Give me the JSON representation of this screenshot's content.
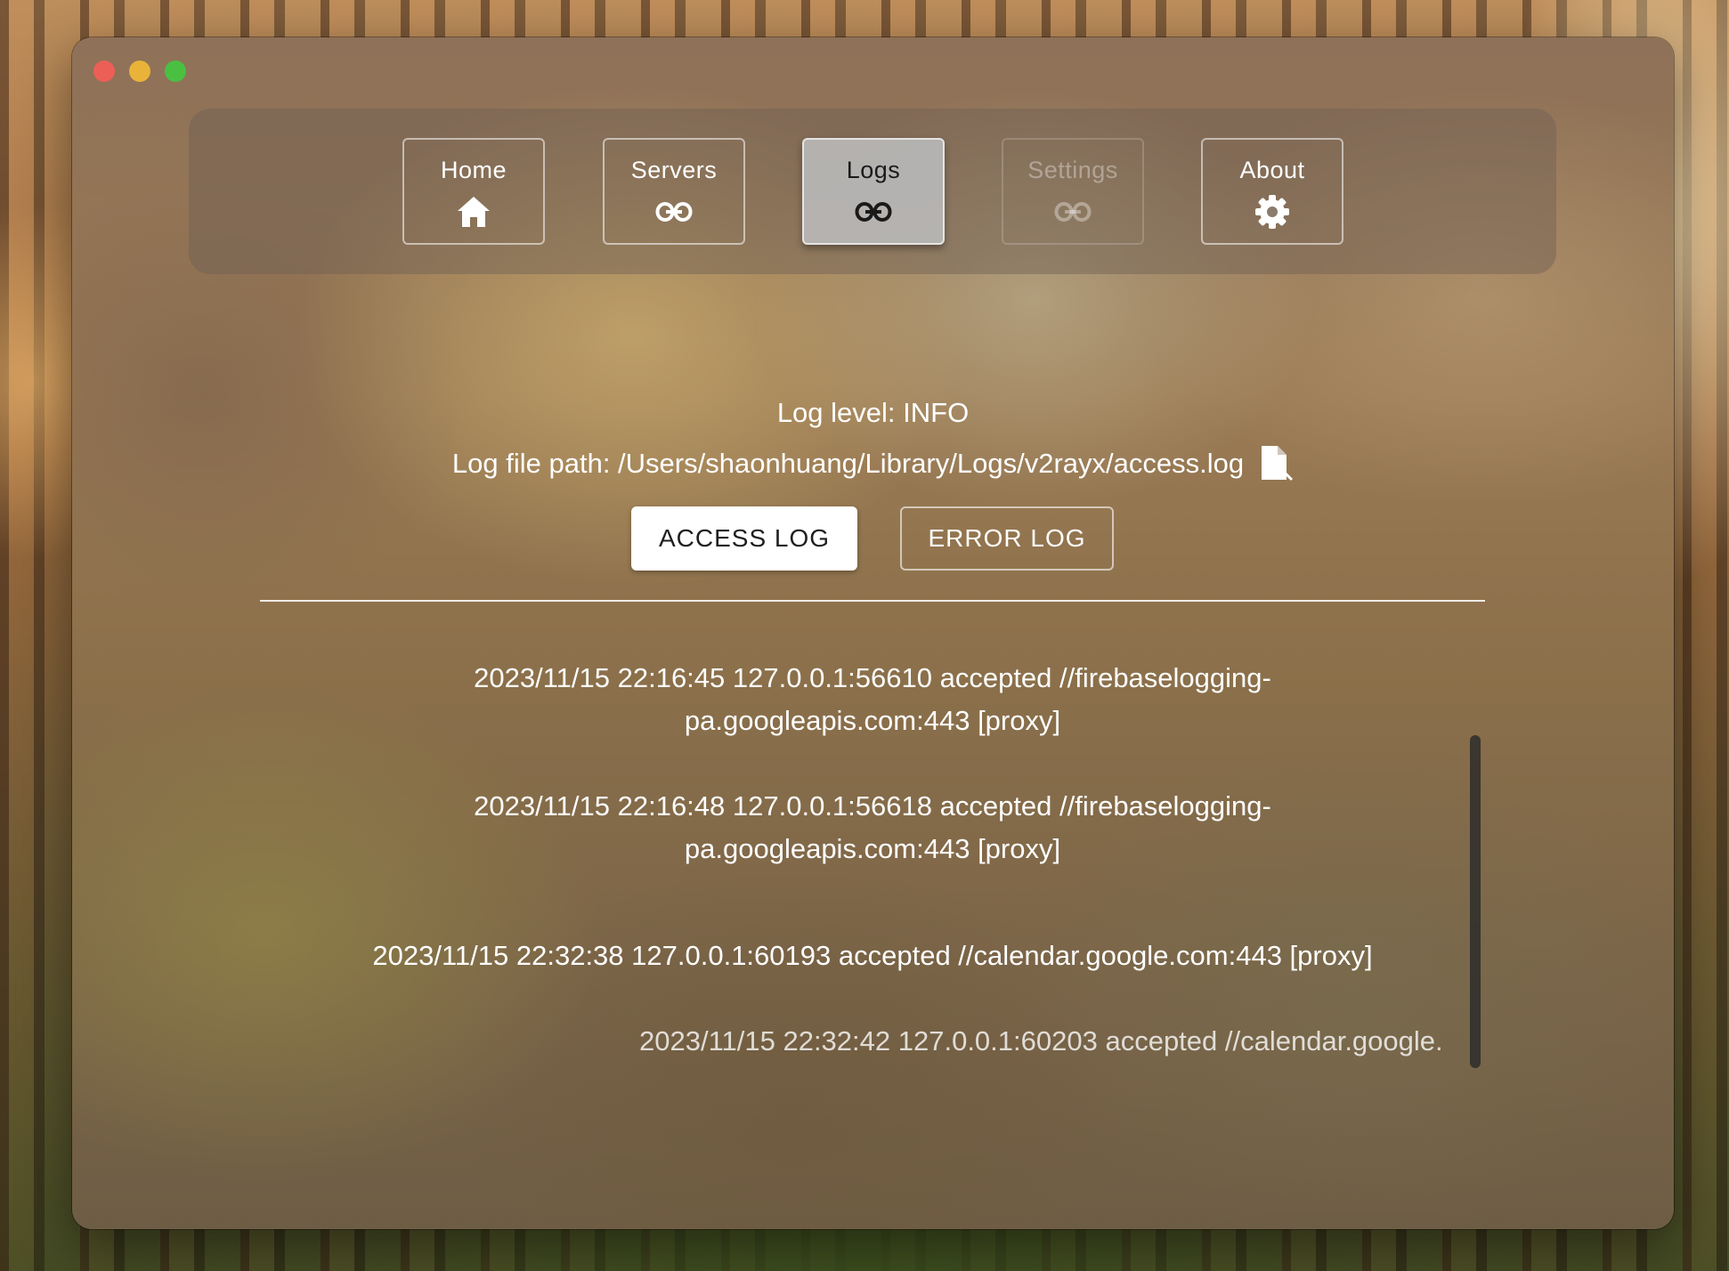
{
  "window_controls": [
    "close",
    "minimize",
    "zoom"
  ],
  "nav": {
    "items": [
      {
        "label": "Home",
        "icon": "home-icon",
        "state": "normal"
      },
      {
        "label": "Servers",
        "icon": "link-icon",
        "state": "normal"
      },
      {
        "label": "Logs",
        "icon": "link-icon",
        "state": "active"
      },
      {
        "label": "Settings",
        "icon": "link-icon",
        "state": "disabled"
      },
      {
        "label": "About",
        "icon": "gear-icon",
        "state": "normal"
      }
    ]
  },
  "log_info": {
    "level_text": "Log level: INFO",
    "path_text": "Log file path: /Users/shaonhuang/Library/Logs/v2rayx/access.log",
    "path_icon": "file-open-icon"
  },
  "log_tabs": {
    "access_label": "ACCESS LOG",
    "error_label": "ERROR LOG",
    "selected": "ACCESS LOG"
  },
  "log_entries": [
    {
      "line1": "2023/11/15 22:16:45 127.0.0.1:56610 accepted //firebaselogging-",
      "line2": "pa.googleapis.com:443 [proxy]"
    },
    {
      "line1": "2023/11/15 22:16:48 127.0.0.1:56618 accepted //firebaselogging-",
      "line2": "pa.googleapis.com:443 [proxy]"
    },
    {
      "line1": "2023/11/15 22:32:38 127.0.0.1:60193 accepted //calendar.google.com:443 [proxy]",
      "line2": ""
    },
    {
      "line1": "2023/11/15 22:32:42 127.0.0.1:60203 accepted //calendar.google.",
      "line2": ""
    }
  ],
  "colors": {
    "active_tab_bg": "#b9b9b9",
    "close": "#ec5f57",
    "minimize": "#e9b33a",
    "zoom": "#4ac042"
  }
}
